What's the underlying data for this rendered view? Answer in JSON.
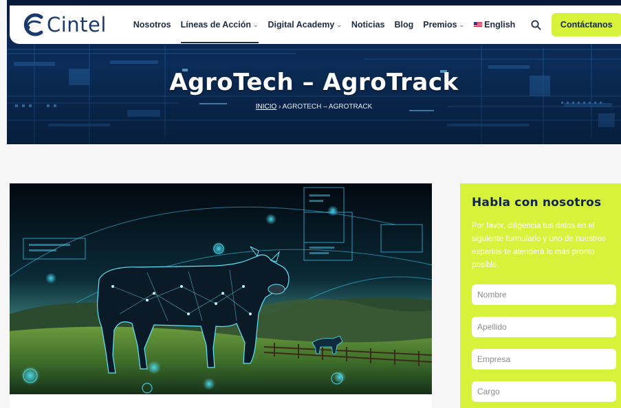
{
  "brand": {
    "name": "Cintel"
  },
  "nav": {
    "items": [
      {
        "label": "Nosotros",
        "dropdown": false
      },
      {
        "label": "Líneas de Acción",
        "dropdown": true
      },
      {
        "label": "Digital Academy",
        "dropdown": true
      },
      {
        "label": "Noticias",
        "dropdown": false
      },
      {
        "label": "Blog",
        "dropdown": false
      },
      {
        "label": "Premios",
        "dropdown": true
      }
    ],
    "language": "English",
    "cta": "Contáctanos"
  },
  "hero": {
    "title": "AgroTech – AgroTrack",
    "breadcrumb": {
      "home": "INICIO",
      "separator": "›",
      "current": "AGROTECH – AGROTRACK"
    }
  },
  "contact_form": {
    "title": "Habla con nosotros",
    "intro": "Por favor, diligencia tus datos en el siguiente formulario y uno de nuestros expertos te atenderá lo más pronto posible.",
    "fields": [
      {
        "placeholder": "Nombre",
        "value": ""
      },
      {
        "placeholder": "Apellido",
        "value": ""
      },
      {
        "placeholder": "Empresa",
        "value": ""
      },
      {
        "placeholder": "Cargo",
        "value": ""
      }
    ]
  },
  "colors": {
    "accent": "#d6f23a",
    "brand": "#1a3a6e",
    "text_dark": "#12244a",
    "hero_bg": "#0b3160"
  }
}
